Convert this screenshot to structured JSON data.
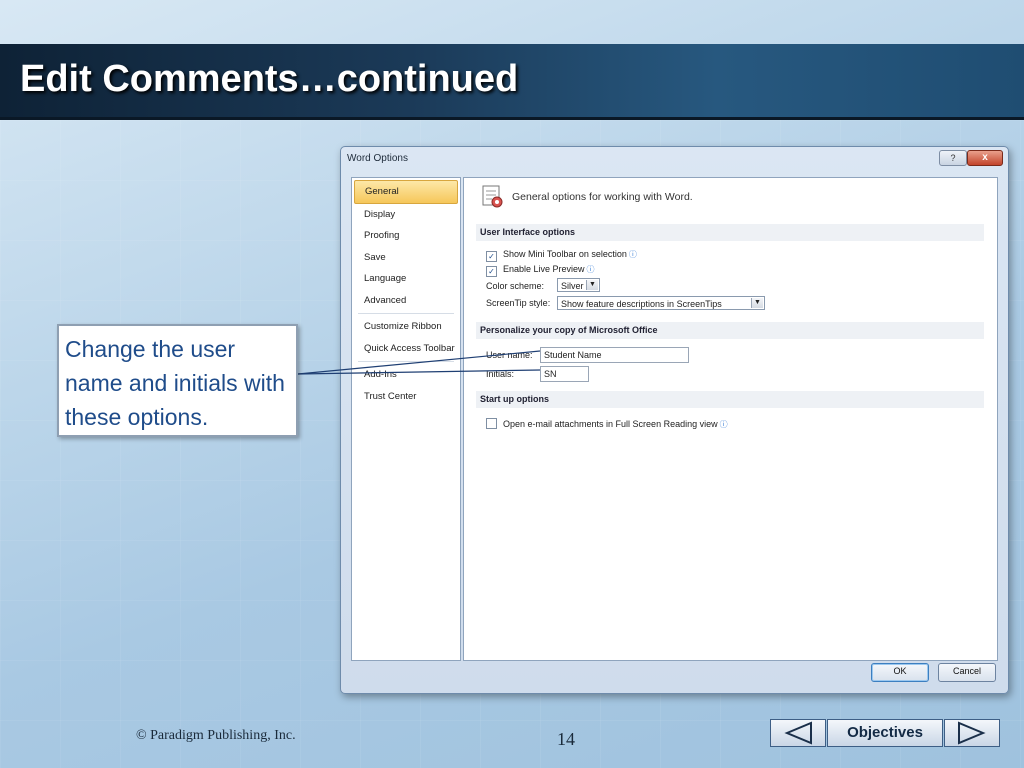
{
  "slide": {
    "title": "Edit Comments…continued",
    "callout": "Change the user name and initials with these options.",
    "copyright": "© Paradigm Publishing, Inc.",
    "page_number": "14",
    "objectives_label": "Objectives"
  },
  "dialog": {
    "title": "Word Options",
    "help_label": "?",
    "close_label": "x",
    "nav_items": [
      {
        "label": "General",
        "active": true
      },
      {
        "label": "Display"
      },
      {
        "label": "Proofing"
      },
      {
        "label": "Save"
      },
      {
        "label": "Language"
      },
      {
        "label": "Advanced"
      },
      {
        "label": "Customize Ribbon"
      },
      {
        "label": "Quick Access Toolbar"
      },
      {
        "label": "Add-Ins"
      },
      {
        "label": "Trust Center"
      }
    ],
    "header": "General options for working with Word.",
    "sections": {
      "ui": "User Interface options",
      "personalize": "Personalize your copy of Microsoft Office",
      "startup": "Start up options"
    },
    "options": {
      "mini_toolbar": {
        "label": "Show Mini Toolbar on selection",
        "checked": true
      },
      "live_preview": {
        "label": "Enable Live Preview",
        "checked": true
      },
      "color_scheme_label": "Color scheme:",
      "color_scheme_value": "Silver",
      "screentip_label": "ScreenTip style:",
      "screentip_value": "Show feature descriptions in ScreenTips",
      "user_name_label": "User name:",
      "user_name_value": "Student Name",
      "initials_label": "Initials:",
      "initials_value": "SN",
      "email_attachments": {
        "label": "Open e-mail attachments in Full Screen Reading view",
        "checked": false
      }
    },
    "buttons": {
      "ok": "OK",
      "cancel": "Cancel"
    }
  },
  "colors": {
    "title_bar": "#1b3a58",
    "callout_text": "#1f4c8a",
    "active_nav": "#f6c75a"
  }
}
